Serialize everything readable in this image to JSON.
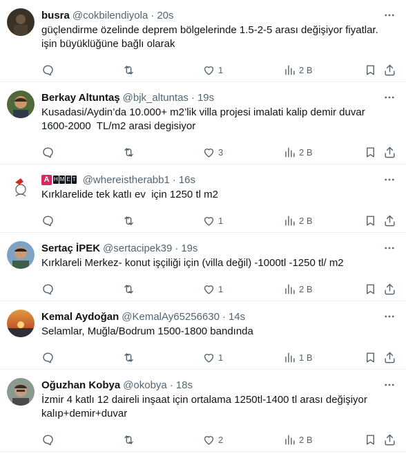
{
  "tweets": [
    {
      "name": "busra",
      "handle": "@cokbilendiyola",
      "dot": "·",
      "time": "20s",
      "text": "güçlendirme özelinde deprem bölgelerinde 1.5-2-5 arası değişiyor fiyatlar.\nişin büyüklüğüne bağlı olarak",
      "likes": "1",
      "views": "2 B",
      "avatar_colors": [
        "#3a3226",
        "#6b5a44"
      ]
    },
    {
      "name": "Berkay Altuntaş",
      "handle": "@bjk_altuntas",
      "dot": "·",
      "time": "19s",
      "text": "Kusadasi/Aydin’da 10.000+ m2’lik villa projesi imalati kalip demir duvar\n1600-2000  TL/m2 arasi degisiyor",
      "likes": "3",
      "views": "2 B",
      "avatar_colors": [
        "#4f6a3a",
        "#c9956a"
      ]
    },
    {
      "name": "",
      "badge_letters": [
        "A",
        "H",
        "M",
        "E",
        "T"
      ],
      "handle": "@whereistherabb1",
      "dot": "·",
      "time": "16s",
      "text": "Kırklarelide tek katlı ev  için 1250 tl m2",
      "likes": "1",
      "views": "2 B",
      "avatar_colors": [
        "#ffffff",
        "#d9261c"
      ]
    },
    {
      "name": "Sertaç İPEK",
      "handle": "@sertacipek39",
      "dot": "·",
      "time": "19s",
      "text": "Kırklareli Merkez- konut işçiliği için (villa değil) -1000tl -1250 tl/ m2",
      "likes": "1",
      "views": "2 B",
      "avatar_colors": [
        "#7da3c4",
        "#c89a76"
      ]
    },
    {
      "name": "Kemal Aydoğan",
      "handle": "@KemalAy65256630",
      "dot": "·",
      "time": "14s",
      "text": "Selamlar, Muğla/Bodrum 1500-1800 bandında",
      "likes": "1",
      "views": "1 B",
      "avatar_colors": [
        "#e29a3c",
        "#3b3a4a"
      ]
    },
    {
      "name": "Oğuzhan Kobya",
      "handle": "@okobya",
      "dot": "·",
      "time": "18s",
      "text": "İzmir 4 katlı 12 daireli inşaat için ortalama 1250tl-1400 tl arası değişiyor\nkalıp+demir+duvar",
      "likes": "2",
      "views": "2 B",
      "avatar_colors": [
        "#8a9a8e",
        "#c79b7c"
      ]
    }
  ]
}
